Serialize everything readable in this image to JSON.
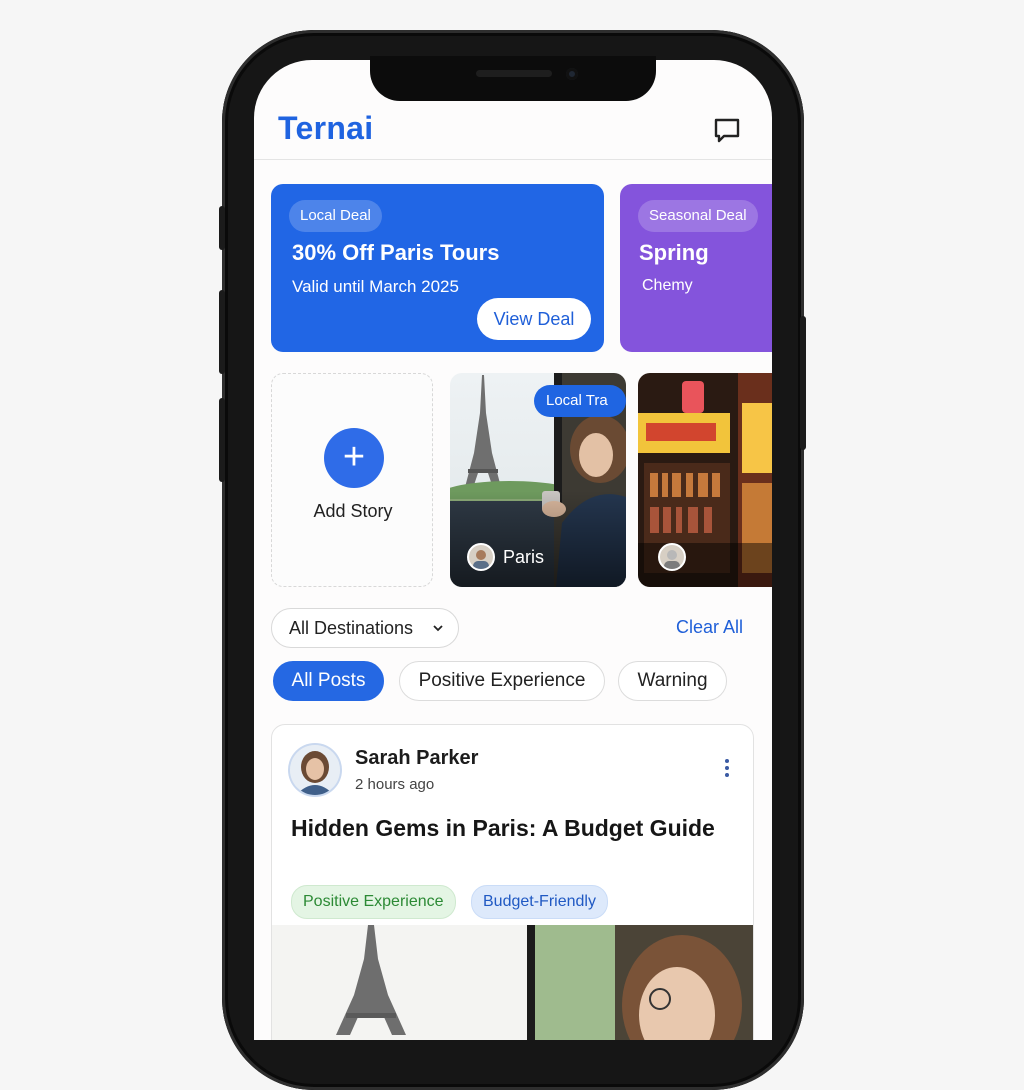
{
  "app": {
    "title": "Ternai"
  },
  "deals": [
    {
      "badge": "Local Deal",
      "title": "30% Off Paris Tours",
      "subtitle": "Valid until March 2025",
      "button": "View Deal",
      "color": "#2166e5"
    },
    {
      "badge": "Seasonal Deal",
      "title": "Spring",
      "subtitle": "Chemy",
      "color": "#8454dc"
    }
  ],
  "stories": {
    "add_label": "Add Story",
    "items": [
      {
        "name": "Paris",
        "badge": "Local Tra"
      },
      {
        "name": ""
      }
    ]
  },
  "filters": {
    "destination": "All Destinations",
    "clear_label": "Clear All",
    "chips": [
      "All Posts",
      "Positive Experience",
      "Warning"
    ],
    "active_chip": "All Posts"
  },
  "post": {
    "author": "Sarah Parker",
    "time": "2 hours ago",
    "title": "Hidden Gems in Paris: A Budget Guide",
    "tags": [
      "Positive Experience",
      "Budget-Friendly"
    ]
  },
  "icons": [
    "chat-icon",
    "plus-icon",
    "chevron-down-icon",
    "more-vertical-icon"
  ],
  "colors": {
    "accent": "#1f63e0",
    "deal_primary": "#2166e5",
    "deal_secondary": "#8454dc",
    "tag_green": "#2c8a35",
    "tag_blue": "#2059c3"
  }
}
